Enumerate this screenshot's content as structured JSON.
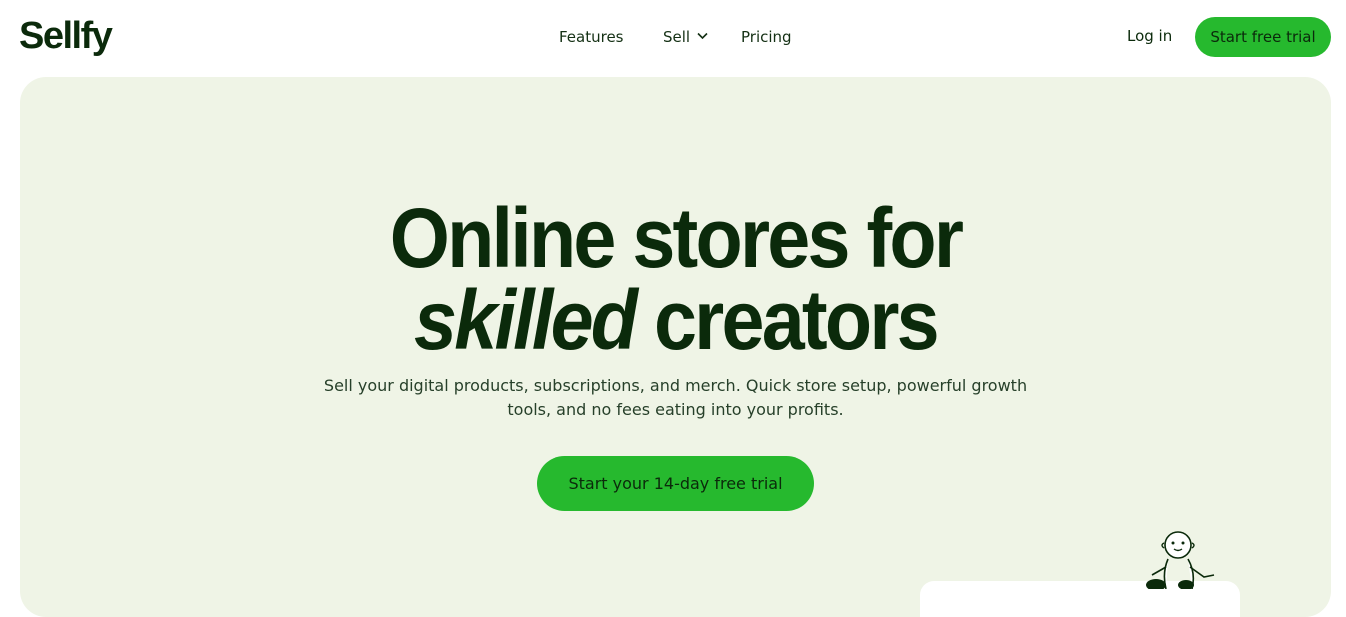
{
  "brand": {
    "name": "Sellfy"
  },
  "nav": {
    "features": "Features",
    "sell": "Sell",
    "pricing": "Pricing"
  },
  "header": {
    "login": "Log in",
    "cta": "Start free trial"
  },
  "hero": {
    "headline_line1": "Online stores for",
    "headline_line2_italic": "skilled",
    "headline_line2_rest": " creators",
    "subtitle_line1": "Sell your digital products, subscriptions, and merch. Quick store setup, powerful growth",
    "subtitle_line2": "tools, and no fees eating into your profits.",
    "cta": "Start your 14-day free trial"
  },
  "colors": {
    "accent": "#26b92e",
    "hero_bg": "#eff4e6",
    "text_dark": "#0b2a0b"
  }
}
